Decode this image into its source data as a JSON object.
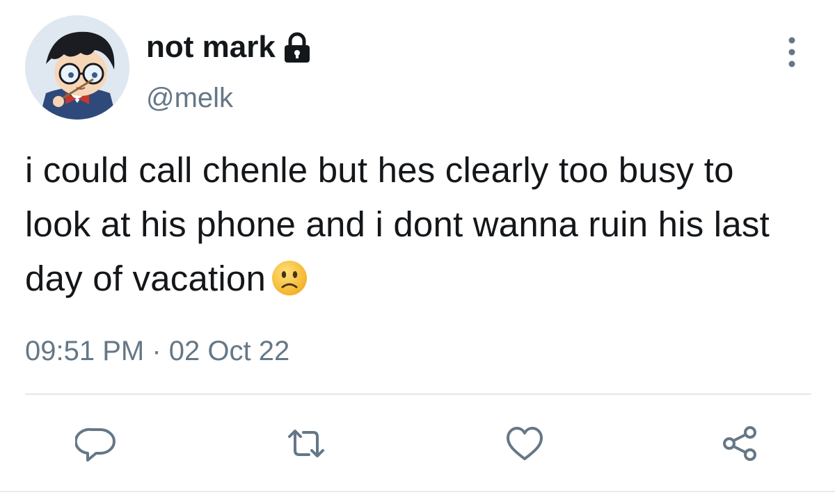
{
  "tweet": {
    "display_name": "not mark",
    "handle": "@melk",
    "text": "i could call chenle but hes clearly too busy to look at his phone and i dont wanna ruin his last day of vacation",
    "text_emoji": "slightly-frowning-face",
    "timestamp": "09:51 PM · 02 Oct 22",
    "protected_icon": "lock-icon",
    "avatar": "avatar-anime-boy-glasses"
  },
  "actions": [
    {
      "name": "reply",
      "icon": "reply-icon"
    },
    {
      "name": "retweet",
      "icon": "retweet-icon"
    },
    {
      "name": "like",
      "icon": "heart-icon"
    },
    {
      "name": "share",
      "icon": "share-icon"
    }
  ],
  "menu_icon": "more-vertical-icon",
  "colors": {
    "text_primary": "#14171a",
    "text_secondary": "#657786",
    "divider": "#e1e8ed",
    "emoji": "#f5b82e"
  }
}
